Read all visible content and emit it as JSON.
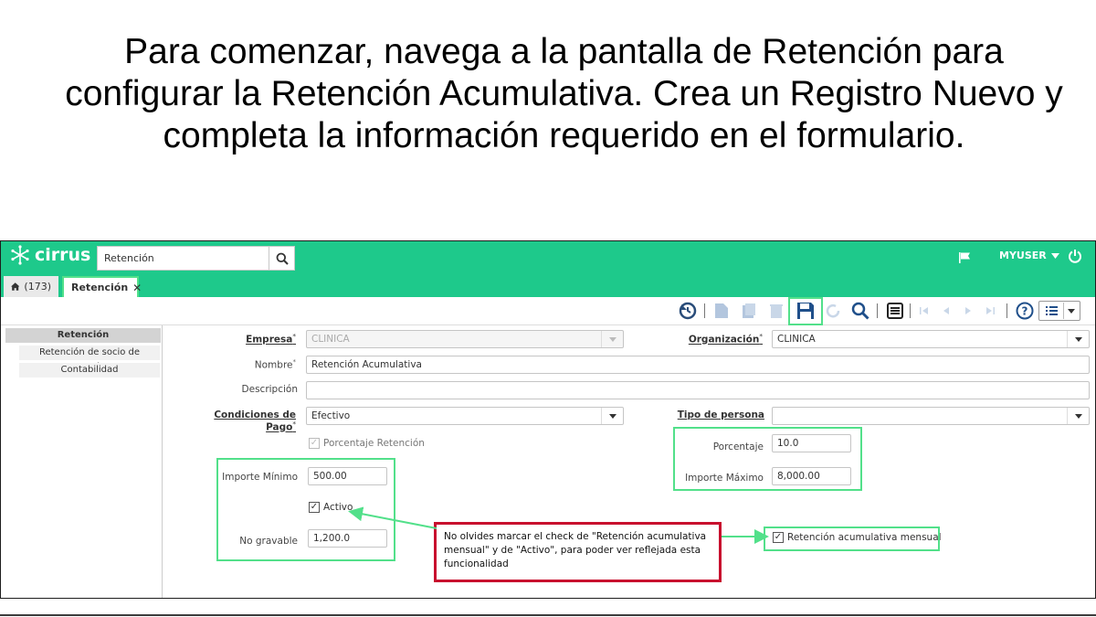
{
  "instruction": "Para comenzar, navega a la pantalla de Retención para configurar la Retención Acumulativa. Crea un Registro Nuevo y completa la información requerido en el formulario.",
  "topbar": {
    "logo_text": "cirrus",
    "search_value": "Retención",
    "user_label": "MYUSER",
    "brand_color": "#1ec98b"
  },
  "tabs": {
    "home_label": "(173)",
    "active_label": "Retención"
  },
  "sidebar": {
    "items": [
      {
        "label": "Retención"
      },
      {
        "label": "Retención de socio de negocios"
      },
      {
        "label": "Contabilidad"
      }
    ]
  },
  "form": {
    "empresa": {
      "label": "Empresa",
      "value": "CLINICA"
    },
    "organizacion": {
      "label": "Organización",
      "value": "CLINICA"
    },
    "nombre": {
      "label": "Nombre",
      "value": "Retención Acumulativa"
    },
    "descripcion": {
      "label": "Descripción",
      "value": ""
    },
    "condiciones": {
      "label": "Condiciones de Pago",
      "value": "Efectivo"
    },
    "tipo_persona": {
      "label": "Tipo de persona",
      "value": ""
    },
    "porcentaje_retencion": {
      "label": "Porcentaje Retención",
      "checked": true
    },
    "porcentaje": {
      "label": "Porcentaje",
      "value": "10.0"
    },
    "importe_minimo": {
      "label": "Importe Mínimo",
      "value": "500.00"
    },
    "importe_maximo": {
      "label": "Importe Máximo",
      "value": "8,000.00"
    },
    "activo": {
      "label": "Activo",
      "checked": true
    },
    "no_gravable": {
      "label": "No gravable",
      "value": "1,200.0"
    },
    "retencion_acumulativa": {
      "label": "Retención acumulativa mensual",
      "checked": true
    }
  },
  "callout": {
    "text": "No olvides marcar el check de \"Retención acumulativa mensual\" y de \"Activo\", para poder ver reflejada esta funcionalidad"
  },
  "highlight_color": "#52e08a",
  "callout_border_color": "#c8102e"
}
